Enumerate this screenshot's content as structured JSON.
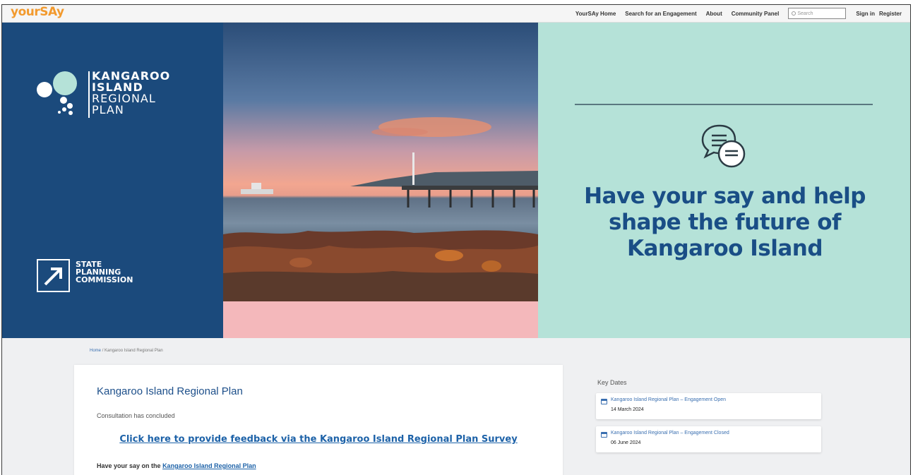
{
  "header": {
    "logo": "yourSAy",
    "nav": [
      "YourSAy Home",
      "Search for an Engagement",
      "About",
      "Community Panel"
    ],
    "search_placeholder": "Search",
    "sign_in": "Sign in",
    "register": "Register"
  },
  "hero": {
    "plan_logo_lines": [
      "KANGAROO",
      "ISLAND",
      "REGIONAL",
      "PLAN"
    ],
    "commission_lines": [
      "STATE",
      "PLANNING",
      "COMMISSION"
    ],
    "headline_lines": [
      "Have your say and help",
      "shape the future of",
      "Kangaroo Island"
    ]
  },
  "breadcrumb": {
    "home": "Home",
    "separator": "/",
    "current": "Kangaroo Island Regional Plan"
  },
  "main": {
    "title": "Kangaroo Island Regional Plan",
    "status": "Consultation has concluded",
    "survey_link": "Click here to provide feedback via the Kangaroo Island Regional Plan Survey",
    "have_say_prefix": "Have your say on the",
    "have_say_link": "Kangaroo Island Regional Plan"
  },
  "key_dates": {
    "title": "Key Dates",
    "items": [
      {
        "label": "Kangaroo Island Regional Plan – Engagement Open",
        "date": "14 March 2024"
      },
      {
        "label": "Kangaroo Island Regional Plan – Engagement Closed",
        "date": "06 June 2024"
      }
    ]
  },
  "colors": {
    "brand_orange": "#f29a2e",
    "navy": "#1b4a7c",
    "teal": "#b5e2d8",
    "pink": "#f4b8bb",
    "link_blue": "#1d62a8"
  }
}
